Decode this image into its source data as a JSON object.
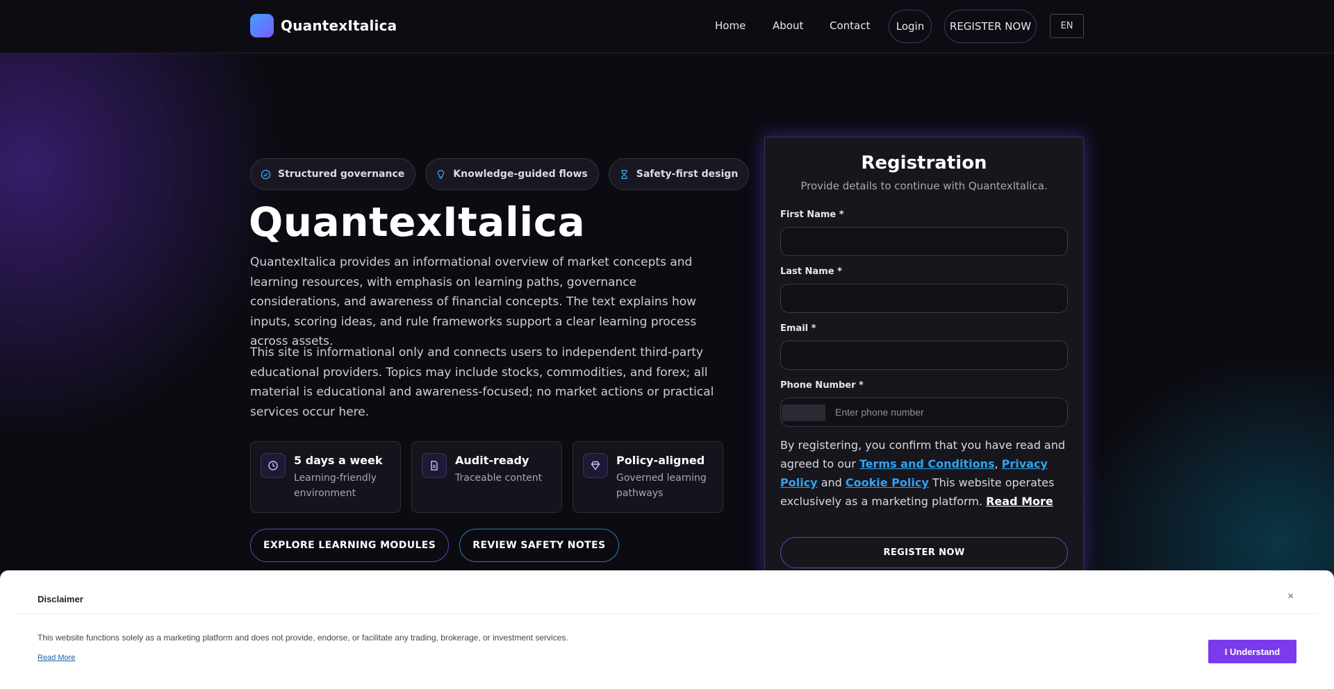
{
  "header": {
    "brand": "QuantexItalica",
    "nav": [
      "Home",
      "About",
      "Contact"
    ],
    "login": "Login",
    "register": "REGISTER NOW",
    "lang": "EN"
  },
  "hero": {
    "tags": [
      {
        "label": "Structured governance",
        "icon": "check-circle-icon"
      },
      {
        "label": "Knowledge-guided flows",
        "icon": "lightbulb-icon"
      },
      {
        "label": "Safety-first design",
        "icon": "hourglass-icon"
      }
    ],
    "title": "QuantexItalica",
    "paragraph1": "QuantexItalica provides an informational overview of market concepts and learning resources, with emphasis on learning paths, governance considerations, and awareness of financial concepts. The text explains how inputs, scoring ideas, and rule frameworks support a clear learning process across assets.",
    "paragraph2": "This site is informational only and connects users to independent third-party educational providers. Topics may include stocks, commodities, and forex; all material is educational and awareness-focused; no market actions or practical services occur here.",
    "features": [
      {
        "title": "5 days a week",
        "subtitle": "Learning-friendly environment",
        "icon": "clock-icon"
      },
      {
        "title": "Audit-ready",
        "subtitle": "Traceable content",
        "icon": "document-icon"
      },
      {
        "title": "Policy-aligned",
        "subtitle": "Governed learning pathways",
        "icon": "diamond-icon"
      }
    ],
    "cta_primary": "EXPLORE LEARNING MODULES",
    "cta_secondary": "REVIEW SAFETY NOTES"
  },
  "form": {
    "title": "Registration",
    "subtitle": "Provide details to continue with QuantexItalica.",
    "first_name_label": "First Name *",
    "last_name_label": "Last Name *",
    "email_label": "Email *",
    "phone_label": "Phone Number *",
    "phone_placeholder": "Enter phone number",
    "consent_prefix": "By registering, you confirm that you have read and agreed to our ",
    "terms": "Terms and Conditions",
    "privacy": "Privacy Policy",
    "and": "and",
    "cookie": "Cookie Policy",
    "consent_suffix": " This website operates exclusively as a marketing platform. ",
    "read_more": "Read More",
    "submit": "REGISTER NOW"
  },
  "disclaimer": {
    "title": "Disclaimer",
    "text": "This website functions solely as a marketing platform and does not provide, endorse, or facilitate any trading, brokerage, or investment services.",
    "read_more": "Read More",
    "accept": "I Understand",
    "close": "×"
  },
  "colors": {
    "accent": "#7c3aed",
    "link": "#2fa4ef",
    "background": "#0c0b12",
    "card": "#17161d"
  }
}
